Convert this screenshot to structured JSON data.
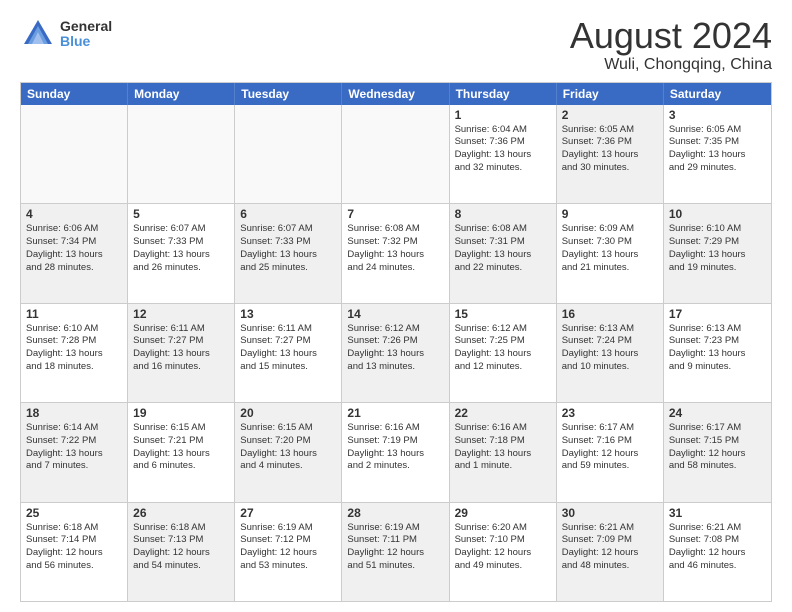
{
  "logo": {
    "general": "General",
    "blue": "Blue"
  },
  "header": {
    "title": "August 2024",
    "subtitle": "Wuli, Chongqing, China"
  },
  "weekdays": [
    "Sunday",
    "Monday",
    "Tuesday",
    "Wednesday",
    "Thursday",
    "Friday",
    "Saturday"
  ],
  "rows": [
    [
      {
        "day": "",
        "info": "",
        "empty": true
      },
      {
        "day": "",
        "info": "",
        "empty": true
      },
      {
        "day": "",
        "info": "",
        "empty": true
      },
      {
        "day": "",
        "info": "",
        "empty": true
      },
      {
        "day": "1",
        "info": "Sunrise: 6:04 AM\nSunset: 7:36 PM\nDaylight: 13 hours\nand 32 minutes."
      },
      {
        "day": "2",
        "info": "Sunrise: 6:05 AM\nSunset: 7:36 PM\nDaylight: 13 hours\nand 30 minutes.",
        "shaded": true
      },
      {
        "day": "3",
        "info": "Sunrise: 6:05 AM\nSunset: 7:35 PM\nDaylight: 13 hours\nand 29 minutes."
      }
    ],
    [
      {
        "day": "4",
        "info": "Sunrise: 6:06 AM\nSunset: 7:34 PM\nDaylight: 13 hours\nand 28 minutes.",
        "shaded": true
      },
      {
        "day": "5",
        "info": "Sunrise: 6:07 AM\nSunset: 7:33 PM\nDaylight: 13 hours\nand 26 minutes."
      },
      {
        "day": "6",
        "info": "Sunrise: 6:07 AM\nSunset: 7:33 PM\nDaylight: 13 hours\nand 25 minutes.",
        "shaded": true
      },
      {
        "day": "7",
        "info": "Sunrise: 6:08 AM\nSunset: 7:32 PM\nDaylight: 13 hours\nand 24 minutes."
      },
      {
        "day": "8",
        "info": "Sunrise: 6:08 AM\nSunset: 7:31 PM\nDaylight: 13 hours\nand 22 minutes.",
        "shaded": true
      },
      {
        "day": "9",
        "info": "Sunrise: 6:09 AM\nSunset: 7:30 PM\nDaylight: 13 hours\nand 21 minutes."
      },
      {
        "day": "10",
        "info": "Sunrise: 6:10 AM\nSunset: 7:29 PM\nDaylight: 13 hours\nand 19 minutes.",
        "shaded": true
      }
    ],
    [
      {
        "day": "11",
        "info": "Sunrise: 6:10 AM\nSunset: 7:28 PM\nDaylight: 13 hours\nand 18 minutes."
      },
      {
        "day": "12",
        "info": "Sunrise: 6:11 AM\nSunset: 7:27 PM\nDaylight: 13 hours\nand 16 minutes.",
        "shaded": true
      },
      {
        "day": "13",
        "info": "Sunrise: 6:11 AM\nSunset: 7:27 PM\nDaylight: 13 hours\nand 15 minutes."
      },
      {
        "day": "14",
        "info": "Sunrise: 6:12 AM\nSunset: 7:26 PM\nDaylight: 13 hours\nand 13 minutes.",
        "shaded": true
      },
      {
        "day": "15",
        "info": "Sunrise: 6:12 AM\nSunset: 7:25 PM\nDaylight: 13 hours\nand 12 minutes."
      },
      {
        "day": "16",
        "info": "Sunrise: 6:13 AM\nSunset: 7:24 PM\nDaylight: 13 hours\nand 10 minutes.",
        "shaded": true
      },
      {
        "day": "17",
        "info": "Sunrise: 6:13 AM\nSunset: 7:23 PM\nDaylight: 13 hours\nand 9 minutes."
      }
    ],
    [
      {
        "day": "18",
        "info": "Sunrise: 6:14 AM\nSunset: 7:22 PM\nDaylight: 13 hours\nand 7 minutes.",
        "shaded": true
      },
      {
        "day": "19",
        "info": "Sunrise: 6:15 AM\nSunset: 7:21 PM\nDaylight: 13 hours\nand 6 minutes."
      },
      {
        "day": "20",
        "info": "Sunrise: 6:15 AM\nSunset: 7:20 PM\nDaylight: 13 hours\nand 4 minutes.",
        "shaded": true
      },
      {
        "day": "21",
        "info": "Sunrise: 6:16 AM\nSunset: 7:19 PM\nDaylight: 13 hours\nand 2 minutes."
      },
      {
        "day": "22",
        "info": "Sunrise: 6:16 AM\nSunset: 7:18 PM\nDaylight: 13 hours\nand 1 minute.",
        "shaded": true
      },
      {
        "day": "23",
        "info": "Sunrise: 6:17 AM\nSunset: 7:16 PM\nDaylight: 12 hours\nand 59 minutes."
      },
      {
        "day": "24",
        "info": "Sunrise: 6:17 AM\nSunset: 7:15 PM\nDaylight: 12 hours\nand 58 minutes.",
        "shaded": true
      }
    ],
    [
      {
        "day": "25",
        "info": "Sunrise: 6:18 AM\nSunset: 7:14 PM\nDaylight: 12 hours\nand 56 minutes."
      },
      {
        "day": "26",
        "info": "Sunrise: 6:18 AM\nSunset: 7:13 PM\nDaylight: 12 hours\nand 54 minutes.",
        "shaded": true
      },
      {
        "day": "27",
        "info": "Sunrise: 6:19 AM\nSunset: 7:12 PM\nDaylight: 12 hours\nand 53 minutes."
      },
      {
        "day": "28",
        "info": "Sunrise: 6:19 AM\nSunset: 7:11 PM\nDaylight: 12 hours\nand 51 minutes.",
        "shaded": true
      },
      {
        "day": "29",
        "info": "Sunrise: 6:20 AM\nSunset: 7:10 PM\nDaylight: 12 hours\nand 49 minutes."
      },
      {
        "day": "30",
        "info": "Sunrise: 6:21 AM\nSunset: 7:09 PM\nDaylight: 12 hours\nand 48 minutes.",
        "shaded": true
      },
      {
        "day": "31",
        "info": "Sunrise: 6:21 AM\nSunset: 7:08 PM\nDaylight: 12 hours\nand 46 minutes."
      }
    ]
  ]
}
